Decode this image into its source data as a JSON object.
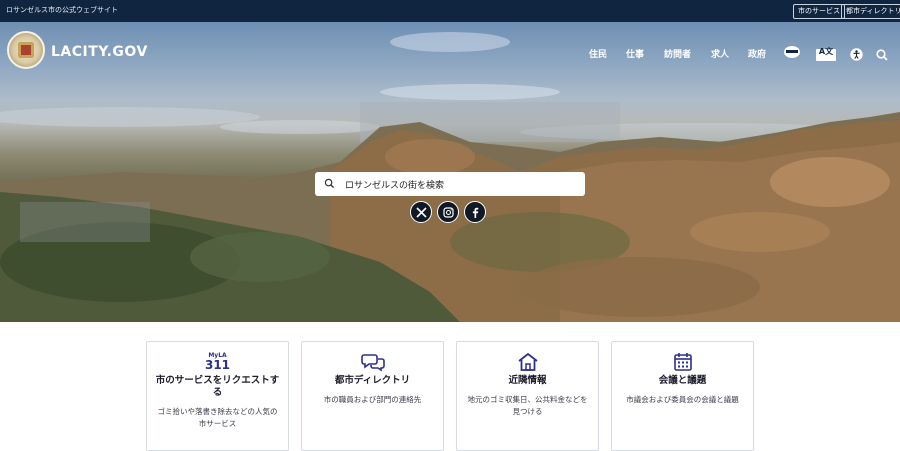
{
  "topbar": {
    "official_text": "ロサンゼルス市の公式ウェブサイト",
    "services_btn": "市のサービス",
    "directory_btn": "都市ディレクトリ"
  },
  "header": {
    "site_name": "LACITY.GOV",
    "nav": [
      "住民",
      "仕事",
      "訪問者",
      "求人",
      "政府"
    ],
    "language_badge": "A文"
  },
  "search": {
    "placeholder": "ロサンゼルスの街を検索"
  },
  "social": [
    "x-icon",
    "instagram-icon",
    "facebook-icon"
  ],
  "cards": [
    {
      "icon_top": "MyLA",
      "icon_bottom": "311",
      "title": "市のサービスをリクエストする",
      "desc": "ゴミ拾いや落書き除去などの人気の市サービス"
    },
    {
      "icon": "chat-icon",
      "title": "都市ディレクトリ",
      "desc": "市の職員および部門の連絡先"
    },
    {
      "icon": "home-icon",
      "title": "近隣情報",
      "desc": "地元のゴミ収集日、公共料金などを見つける"
    },
    {
      "icon": "calendar-icon",
      "title": "会議と議題",
      "desc": "市議会および委員会の会議と議題"
    }
  ],
  "colors": {
    "topbar": "#0f2540",
    "accent": "#2b2f8f"
  }
}
